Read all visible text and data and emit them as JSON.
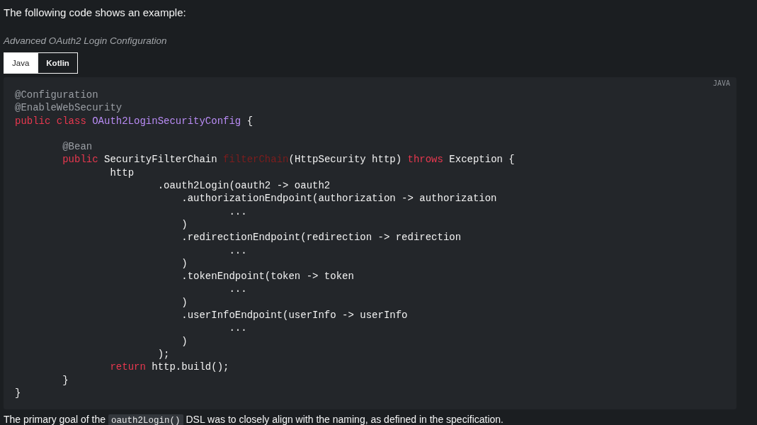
{
  "intro": "The following code shows an example:",
  "caption": "Advanced OAuth2 Login Configuration",
  "tabs": [
    {
      "label": "Java",
      "selected": true
    },
    {
      "label": "Kotlin",
      "selected": false
    }
  ],
  "code_block": {
    "language": "JAVA",
    "lines": [
      {
        "kind": "code",
        "tokens": [
          {
            "kind": "annotation",
            "text": "@Configuration"
          }
        ]
      },
      {
        "kind": "code",
        "tokens": [
          {
            "kind": "annotation",
            "text": "@EnableWebSecurity"
          }
        ]
      },
      {
        "kind": "code",
        "tokens": [
          {
            "kind": "keyword",
            "text": "public class "
          },
          {
            "kind": "type",
            "text": "OAuth2LoginSecurityConfig"
          },
          {
            "kind": "plain",
            "text": " {"
          }
        ]
      },
      {
        "kind": "blank"
      },
      {
        "kind": "code",
        "tokens": [
          {
            "kind": "annotation",
            "text": "        @Bean"
          }
        ]
      },
      {
        "kind": "code",
        "tokens": [
          {
            "kind": "keyword",
            "text": "        public"
          },
          {
            "kind": "plain",
            "text": " SecurityFilterChain "
          },
          {
            "kind": "method",
            "text": "filterChain"
          },
          {
            "kind": "plain",
            "text": "(HttpSecurity http) "
          },
          {
            "kind": "keyword",
            "text": "throws"
          },
          {
            "kind": "plain",
            "text": " Exception {"
          }
        ]
      },
      {
        "kind": "code",
        "tokens": [
          {
            "kind": "plain",
            "text": "                http"
          }
        ]
      },
      {
        "kind": "code",
        "tokens": [
          {
            "kind": "plain",
            "text": "                        .oauth2Login(oauth2 -> oauth2"
          }
        ]
      },
      {
        "kind": "code",
        "tokens": [
          {
            "kind": "plain",
            "text": "                            .authorizationEndpoint(authorization -> authorization"
          }
        ]
      },
      {
        "kind": "code",
        "tokens": [
          {
            "kind": "plain",
            "text": "                                    ..."
          }
        ]
      },
      {
        "kind": "code",
        "tokens": [
          {
            "kind": "plain",
            "text": "                            )"
          }
        ]
      },
      {
        "kind": "code",
        "tokens": [
          {
            "kind": "plain",
            "text": "                            .redirectionEndpoint(redirection -> redirection"
          }
        ]
      },
      {
        "kind": "code",
        "tokens": [
          {
            "kind": "plain",
            "text": "                                    ..."
          }
        ]
      },
      {
        "kind": "code",
        "tokens": [
          {
            "kind": "plain",
            "text": "                            )"
          }
        ]
      },
      {
        "kind": "code",
        "tokens": [
          {
            "kind": "plain",
            "text": "                            .tokenEndpoint(token -> token"
          }
        ]
      },
      {
        "kind": "code",
        "tokens": [
          {
            "kind": "plain",
            "text": "                                    ..."
          }
        ]
      },
      {
        "kind": "code",
        "tokens": [
          {
            "kind": "plain",
            "text": "                            )"
          }
        ]
      },
      {
        "kind": "code",
        "tokens": [
          {
            "kind": "plain",
            "text": "                            .userInfoEndpoint(userInfo -> userInfo"
          }
        ]
      },
      {
        "kind": "code",
        "tokens": [
          {
            "kind": "plain",
            "text": "                                    ..."
          }
        ]
      },
      {
        "kind": "code",
        "tokens": [
          {
            "kind": "plain",
            "text": "                            )"
          }
        ]
      },
      {
        "kind": "code",
        "tokens": [
          {
            "kind": "plain",
            "text": "                        );"
          }
        ]
      },
      {
        "kind": "code",
        "tokens": [
          {
            "kind": "keyword",
            "text": "                return"
          },
          {
            "kind": "plain",
            "text": " http.build();"
          }
        ]
      },
      {
        "kind": "code",
        "tokens": [
          {
            "kind": "plain",
            "text": "        }"
          }
        ]
      },
      {
        "kind": "code",
        "tokens": [
          {
            "kind": "plain",
            "text": "}"
          }
        ]
      }
    ]
  },
  "closing": [
    {
      "kind": "text",
      "text": "The primary goal of the"
    },
    {
      "kind": "code",
      "text": "oauth2Login()"
    },
    {
      "kind": "text",
      "text": "DSL was to closely align with the naming, as defined in the specification."
    }
  ]
}
